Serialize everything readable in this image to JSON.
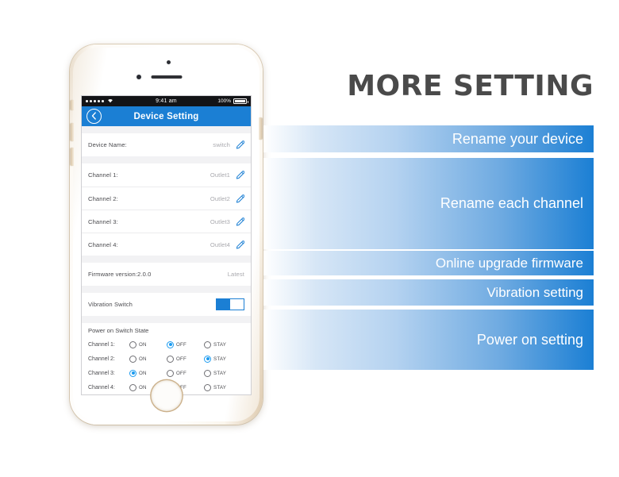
{
  "heading": "MORE SETTING",
  "phone": {
    "status_bar": {
      "signal_dots": 5,
      "wifi_icon": "wifi-icon",
      "time": "9:41 am",
      "battery_percent": "100%",
      "battery_icon": "battery-full-icon"
    },
    "nav_bar": {
      "back_icon": "chevron-left-circle-icon",
      "title": "Device Setting"
    },
    "rows": [
      {
        "label": "Device Name:",
        "value": "switch",
        "edit_icon": "pencil-icon"
      },
      {
        "label": "Channel 1:",
        "value": "Outlet1",
        "edit_icon": "pencil-icon"
      },
      {
        "label": "Channel 2:",
        "value": "Outlet2",
        "edit_icon": "pencil-icon"
      },
      {
        "label": "Channel 3:",
        "value": "Outlet3",
        "edit_icon": "pencil-icon"
      },
      {
        "label": "Channel 4:",
        "value": "Outlet4",
        "edit_icon": "pencil-icon"
      }
    ],
    "firmware": {
      "label": "Firmware version:2.0.0",
      "value": "Latest"
    },
    "vibration": {
      "label": "Vibration Switch",
      "state": "on"
    },
    "power_on": {
      "title": "Power on Switch State",
      "options": [
        "ON",
        "OFF",
        "STAY"
      ],
      "channels": [
        {
          "label": "Channel 1:",
          "selected": "OFF"
        },
        {
          "label": "Channel 2:",
          "selected": "STAY"
        },
        {
          "label": "Channel 3:",
          "selected": "ON"
        },
        {
          "label": "Channel 4:",
          "selected": "OFF"
        }
      ]
    }
  },
  "bands": [
    {
      "text": "Rename your device"
    },
    {
      "text": "Rename each channel"
    },
    {
      "text": "Online upgrade firmware"
    },
    {
      "text": "Vibration setting"
    },
    {
      "text": "Power on setting"
    }
  ],
  "colors": {
    "accent_blue": "#1b7fd4",
    "radio_blue": "#1b9bf0",
    "heading_gray": "#4a4a4a",
    "status_bar": "#131417"
  }
}
